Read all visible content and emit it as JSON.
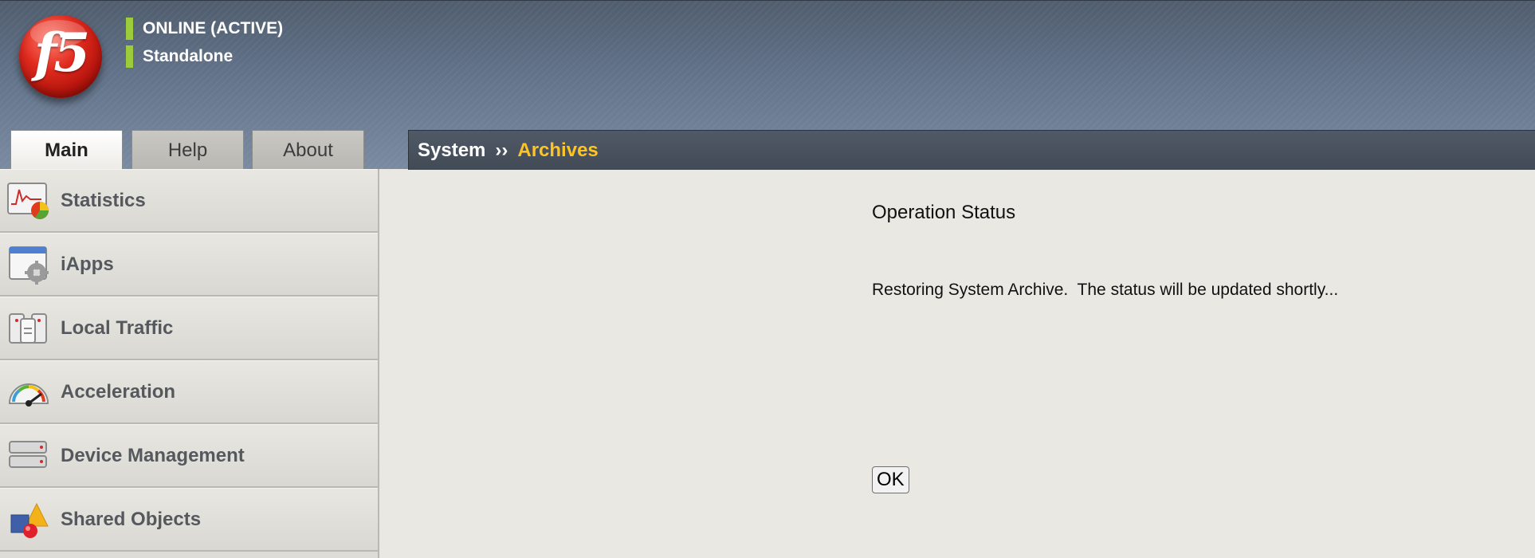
{
  "header": {
    "logo_text": "f5",
    "status": {
      "online": "ONLINE (ACTIVE)",
      "mode": "Standalone",
      "indicator_color": "#9ccc3c"
    }
  },
  "tabs": [
    {
      "label": "Main",
      "active": true
    },
    {
      "label": "Help",
      "active": false
    },
    {
      "label": "About",
      "active": false
    }
  ],
  "breadcrumb": {
    "section": "System",
    "separator": "››",
    "page": "Archives",
    "page_color": "#ffc421"
  },
  "sidebar": {
    "items": [
      {
        "label": "Statistics",
        "icon": "statistics-icon"
      },
      {
        "label": "iApps",
        "icon": "iapps-icon"
      },
      {
        "label": "Local Traffic",
        "icon": "local-traffic-icon"
      },
      {
        "label": "Acceleration",
        "icon": "acceleration-icon"
      },
      {
        "label": "Device Management",
        "icon": "device-management-icon"
      },
      {
        "label": "Shared Objects",
        "icon": "shared-objects-icon"
      }
    ]
  },
  "main": {
    "title": "Operation Status",
    "message": "Restoring System Archive.  The status will be updated shortly...",
    "ok_label": "OK"
  }
}
